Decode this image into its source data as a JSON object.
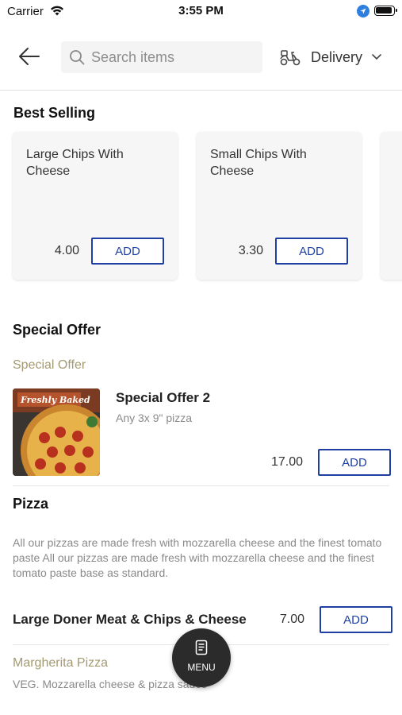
{
  "status_bar": {
    "carrier": "Carrier",
    "time": "3:55 PM"
  },
  "header": {
    "search_placeholder": "Search items",
    "delivery_label": "Delivery"
  },
  "best_selling": {
    "title": "Best Selling",
    "items": [
      {
        "name": "Large Chips With Cheese",
        "price": "4.00",
        "add_label": "ADD"
      },
      {
        "name": "Small Chips With Cheese",
        "price": "3.30",
        "add_label": "ADD"
      }
    ]
  },
  "special_offer": {
    "title": "Special Offer",
    "subcategory": "Special Offer",
    "item": {
      "name": "Special Offer 2",
      "description": "Any 3x 9\" pizza",
      "price": "17.00",
      "add_label": "ADD",
      "image_caption": "Freshly Baked"
    }
  },
  "pizza": {
    "title": "Pizza",
    "description": "All our pizzas are made fresh with mozzarella cheese and the finest tomato paste All our pizzas are made fresh with mozzarella cheese and the finest tomato paste base as standard.",
    "items": [
      {
        "name": "Large Doner Meat & Chips & Cheese",
        "price": "7.00",
        "add_label": "ADD"
      }
    ],
    "next_item": {
      "name": "Margherita Pizza",
      "description": "VEG. Mozzarella cheese & pizza sauce"
    }
  },
  "menu_fab": {
    "label": "MENU",
    "icon": "menu-book-icon"
  },
  "colors": {
    "accent": "#1f3fa3",
    "subcategory": "#a39a72",
    "fab": "#2b2b2b"
  }
}
